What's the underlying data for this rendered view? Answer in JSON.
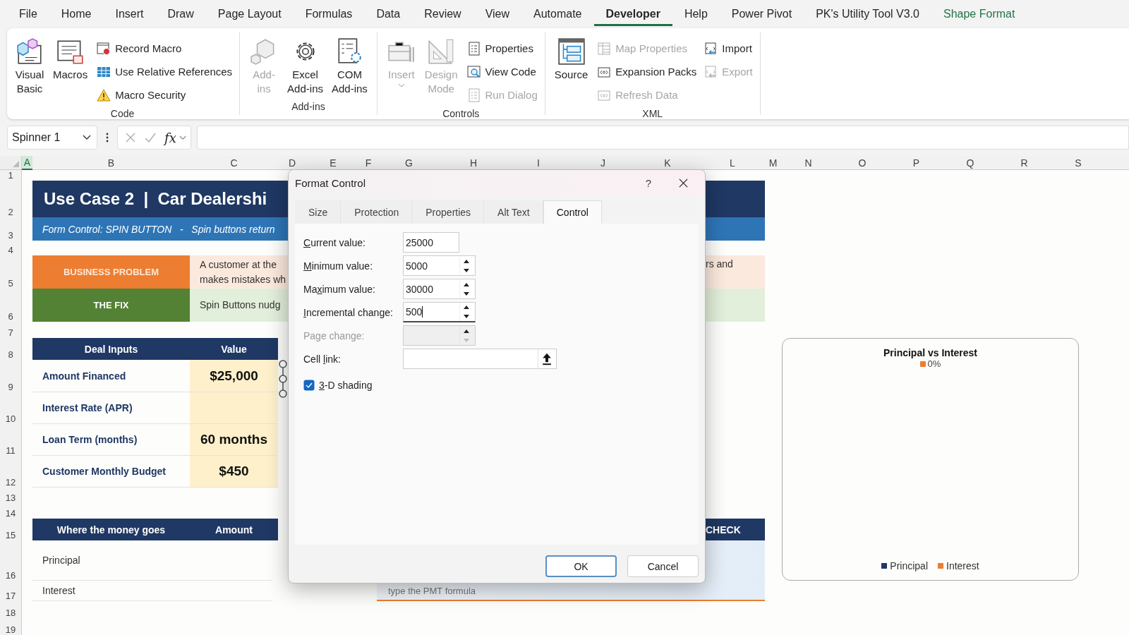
{
  "ribbon_tabs": [
    {
      "label": "File",
      "selected": false,
      "contextual": false
    },
    {
      "label": "Home",
      "selected": false,
      "contextual": false
    },
    {
      "label": "Insert",
      "selected": false,
      "contextual": false
    },
    {
      "label": "Draw",
      "selected": false,
      "contextual": false
    },
    {
      "label": "Page Layout",
      "selected": false,
      "contextual": false
    },
    {
      "label": "Formulas",
      "selected": false,
      "contextual": false
    },
    {
      "label": "Data",
      "selected": false,
      "contextual": false
    },
    {
      "label": "Review",
      "selected": false,
      "contextual": false
    },
    {
      "label": "View",
      "selected": false,
      "contextual": false
    },
    {
      "label": "Automate",
      "selected": false,
      "contextual": false
    },
    {
      "label": "Developer",
      "selected": true,
      "contextual": false
    },
    {
      "label": "Help",
      "selected": false,
      "contextual": false
    },
    {
      "label": "Power Pivot",
      "selected": false,
      "contextual": false
    },
    {
      "label": "PK's Utility Tool V3.0",
      "selected": false,
      "contextual": false
    },
    {
      "label": "Shape Format",
      "selected": false,
      "contextual": true
    }
  ],
  "ribbon": {
    "groups": [
      {
        "label": "Code",
        "large": [
          {
            "lines": [
              "Visual",
              "Basic"
            ],
            "disabled": false,
            "dropdown": false
          },
          {
            "lines": [
              "Macros"
            ],
            "disabled": false,
            "dropdown": false
          }
        ],
        "small_columns": [
          [
            {
              "label": "Record Macro",
              "disabled": false
            },
            {
              "label": "Use Relative References",
              "disabled": false
            },
            {
              "label": "Macro Security",
              "disabled": false
            }
          ]
        ]
      },
      {
        "label": "Add-ins",
        "large": [
          {
            "lines": [
              "Add-",
              "ins"
            ],
            "disabled": true,
            "dropdown": false
          },
          {
            "lines": [
              "Excel",
              "Add-ins"
            ],
            "disabled": false,
            "dropdown": false
          },
          {
            "lines": [
              "COM",
              "Add-ins"
            ],
            "disabled": false,
            "dropdown": false
          }
        ]
      },
      {
        "label": "Controls",
        "large": [
          {
            "lines": [
              "Insert"
            ],
            "disabled": true,
            "dropdown": true
          },
          {
            "lines": [
              "Design",
              "Mode"
            ],
            "disabled": true,
            "dropdown": false
          }
        ],
        "small_columns": [
          [
            {
              "label": "Properties",
              "disabled": false
            },
            {
              "label": "View Code",
              "disabled": false
            },
            {
              "label": "Run Dialog",
              "disabled": true
            }
          ]
        ]
      },
      {
        "label": "XML",
        "large": [
          {
            "lines": [
              "Source"
            ],
            "disabled": false,
            "dropdown": false
          }
        ],
        "small_columns": [
          [
            {
              "label": "Map Properties",
              "disabled": true
            },
            {
              "label": "Expansion Packs",
              "disabled": false
            },
            {
              "label": "Refresh Data",
              "disabled": true
            }
          ],
          [
            {
              "label": "Import",
              "disabled": false
            },
            {
              "label": "Export",
              "disabled": true
            }
          ]
        ]
      }
    ]
  },
  "formula_bar": {
    "name_box": "Spinner 1",
    "function_label": "fx"
  },
  "sheet": {
    "columns": [
      {
        "label": "A",
        "selected": true
      },
      {
        "label": "B",
        "selected": false
      },
      {
        "label": "C",
        "selected": false
      },
      {
        "label": "D",
        "selected": false
      },
      {
        "label": "E",
        "selected": false
      },
      {
        "label": "F",
        "selected": false
      },
      {
        "label": "G",
        "selected": false
      },
      {
        "label": "H",
        "selected": false
      },
      {
        "label": "I",
        "selected": false
      },
      {
        "label": "J",
        "selected": false
      },
      {
        "label": "K",
        "selected": false
      },
      {
        "label": "L",
        "selected": false
      },
      {
        "label": "M",
        "selected": false
      },
      {
        "label": "N",
        "selected": false
      },
      {
        "label": "O",
        "selected": false
      },
      {
        "label": "P",
        "selected": false
      },
      {
        "label": "Q",
        "selected": false
      },
      {
        "label": "R",
        "selected": false
      },
      {
        "label": "S",
        "selected": false
      }
    ],
    "rows": [
      "1",
      "2",
      "3",
      "4",
      "5",
      "6",
      "7",
      "8",
      "9",
      "10",
      "11",
      "12",
      "13",
      "14",
      "15",
      "16",
      "17",
      "18",
      "19"
    ],
    "banner": {
      "title": "Use Case 2  |  Car Dealershi",
      "subtitle": "Form Control: SPIN BUTTON   -   Spin buttons return"
    },
    "problem": {
      "label": "BUSINESS PROBLEM",
      "text_lines": [
        "A customer at the",
        "makes mistakes wh"
      ],
      "text_right": "rs and"
    },
    "fix": {
      "label": "THE FIX",
      "text": "Spin Buttons nudg"
    },
    "deal_inputs": {
      "columns": [
        "Deal Inputs",
        "Value"
      ],
      "rows": [
        {
          "label": "Amount Financed",
          "value": "$25,000"
        },
        {
          "label": "Interest Rate (APR)"
        },
        {
          "label": "Loan Term (months)",
          "value": "60 months"
        },
        {
          "label": "Customer Monthly Budget",
          "value": "$450"
        }
      ]
    },
    "money": {
      "columns": [
        "Where the money goes",
        "Amount"
      ],
      "rows": [
        {
          "label": "Principal"
        },
        {
          "label": "Interest"
        }
      ]
    },
    "check": {
      "header": "CHECK",
      "hint": "type the PMT formula"
    },
    "chart": {
      "title": "Principal vs Interest",
      "data_label": "0%",
      "legend": [
        {
          "name": "Principal",
          "color": "#203864"
        },
        {
          "name": "Interest",
          "color": "#ed7d31"
        }
      ]
    }
  },
  "dialog": {
    "title": "Format Control",
    "help": "?",
    "tabs": [
      {
        "label": "Size",
        "selected": false
      },
      {
        "label": "Protection",
        "selected": false
      },
      {
        "label": "Properties",
        "selected": false
      },
      {
        "label": "Alt Text",
        "selected": false
      },
      {
        "label": "Control",
        "selected": true
      }
    ],
    "fields": [
      {
        "kind": "text",
        "label": {
          "key": "C",
          "after": "urrent value:"
        },
        "value": "25000",
        "disabled": false,
        "focused": false
      },
      {
        "kind": "spin",
        "label": {
          "key": "M",
          "after": "inimum value:"
        },
        "value": "5000",
        "disabled": false,
        "focused": false
      },
      {
        "kind": "spin",
        "label": {
          "before": "Ma",
          "key": "x",
          "after": "imum value:"
        },
        "value": "30000",
        "disabled": false,
        "focused": false
      },
      {
        "kind": "spin",
        "label": {
          "key": "I",
          "after": "ncremental change:"
        },
        "value": "500",
        "disabled": false,
        "focused": true
      },
      {
        "kind": "spin",
        "label": {
          "before": "Page change:"
        },
        "disabled": true,
        "focused": false
      },
      {
        "kind": "reference",
        "label": {
          "before": "Cell ",
          "key": "l",
          "after": "ink:"
        },
        "disabled": false,
        "focused": false
      }
    ],
    "checkbox": {
      "label": {
        "key": "3",
        "after": "-D shading"
      },
      "checked": true
    },
    "buttons": [
      {
        "label": "OK",
        "default": true
      },
      {
        "label": "Cancel",
        "default": false
      }
    ]
  }
}
